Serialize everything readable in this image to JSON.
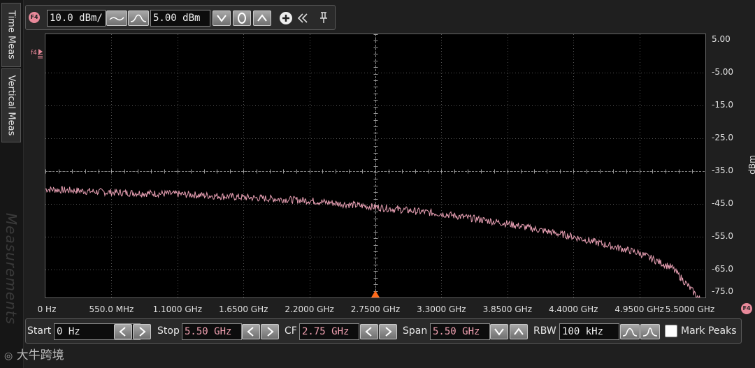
{
  "side_tabs": [
    "Time Meas",
    "Vertical Meas"
  ],
  "side_watermark": "Measurements",
  "scale_bar": {
    "badge": "F4",
    "vertical_scale": "10.0 dBm/",
    "reference_level": "5.00 dBm"
  },
  "plot": {
    "trace_badge": "f4",
    "y_axis_unit": "dBm",
    "y_ticks": [
      "5.00",
      "-5.00",
      "-15.0",
      "-25.0",
      "-35.0",
      "-45.0",
      "-55.0",
      "-65.0",
      "-75.0"
    ],
    "x_ticks": [
      "0 Hz",
      "550.0 MHz",
      "1.1000 GHz",
      "1.6500 GHz",
      "2.2000 GHz",
      "2.7500 GHz",
      "3.3000 GHz",
      "3.8500 GHz",
      "4.4000 GHz",
      "4.9500 GHz",
      "5.5000 GHz"
    ],
    "x_end_badge": "F4"
  },
  "chart_data": {
    "type": "line",
    "xlim": [
      0,
      5.5
    ],
    "ylim": [
      -80,
      5
    ],
    "grid": true,
    "series": [
      {
        "color": "#e8a0b4",
        "x": [
          0,
          0.55,
          1.1,
          1.65,
          2.2,
          2.75,
          3.3,
          3.85,
          4.4,
          4.95,
          5.225,
          5.5
        ],
        "y": [
          -40.5,
          -41.5,
          -42,
          -43,
          -44,
          -46,
          -48,
          -51,
          -55,
          -60,
          -64.5,
          -76
        ]
      }
    ]
  },
  "controls": {
    "start_label": "Start",
    "start_value": "0 Hz",
    "stop_label": "Stop",
    "stop_value": "5.50 GHz",
    "cf_label": "CF",
    "cf_value": "2.75 GHz",
    "span_label": "Span",
    "span_value": "5.50 GHz",
    "rbw_label": "RBW",
    "rbw_value": "100 kHz",
    "mark_peaks_label": "Mark Peaks",
    "mark_peaks_checked": false
  },
  "logo_text": "大牛跨境"
}
